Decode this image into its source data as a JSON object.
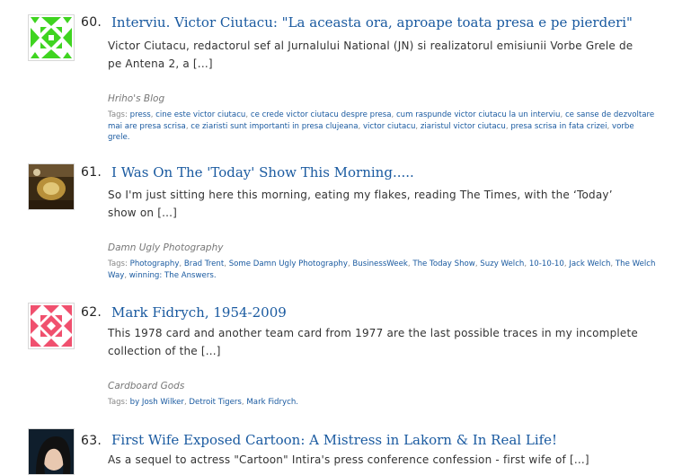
{
  "entries": [
    {
      "number": "60.",
      "title": "Interviu. Victor Ciutacu: \"La aceasta ora, aproape toata presa e pe pierderi\"",
      "excerpt": "Victor Ciutacu, redactorul sef al Jurnalului National (JN) si realizatorul emisiunii Vorbe Grele de pe Antena 2, a [...]",
      "source": "Hriho's Blog",
      "tags_label": "Tags:",
      "tags": [
        "press",
        "cine este victor ciutacu",
        "ce crede victor ciutacu despre presa",
        "cum raspunde victor ciutacu la un interviu",
        "ce sanse de dezvoltare mai are presa scrisa",
        "ce ziaristi sunt importanti in presa clujeana",
        "victor ciutacu",
        "ziaristul victor ciutacu",
        "presa scrisa in fata crizei",
        "vorbe grele."
      ],
      "thumb_color": "#3fd420",
      "thumb_icon": "identicon-green"
    },
    {
      "number": "61.",
      "title": "I Was On The 'Today' Show This Morning.....",
      "excerpt": "So I'm just sitting here this morning, eating my flakes, reading The Times, with the ‘Today’ show on [...]",
      "source": "Damn Ugly Photography",
      "tags_label": "Tags:",
      "tags": [
        "Photography",
        "Brad Trent",
        "Some Damn Ugly Photography",
        "BusinessWeek",
        "The Today Show",
        "Suzy Welch",
        "10-10-10",
        "Jack Welch",
        "The Welch Way",
        "winning: The Answers."
      ],
      "thumb_color": "#8a6a2a",
      "thumb_icon": "photo-thumbnail"
    },
    {
      "number": "62.",
      "title": "Mark Fidrych, 1954-2009",
      "excerpt": "This 1978 card and another team card from 1977 are the last possible traces in my incomplete collection of the [...]",
      "source": "Cardboard Gods",
      "tags_label": "Tags:",
      "tags": [
        "by Josh Wilker",
        "Detroit Tigers",
        "Mark Fidrych."
      ],
      "thumb_color": "#f0506e",
      "thumb_icon": "identicon-pink"
    },
    {
      "number": "63.",
      "title": "First Wife Exposed Cartoon: A Mistress in Lakorn & In Real Life!",
      "excerpt": "As a sequel to actress \"Cartoon\" Intira's press conference confession - first wife of [...]",
      "source": "",
      "tags_label": "",
      "tags": [],
      "thumb_color": "#1a2a3a",
      "thumb_icon": "portrait-thumbnail"
    }
  ]
}
